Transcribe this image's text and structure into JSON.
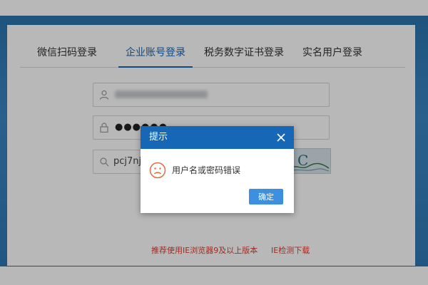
{
  "tabs": [
    {
      "label": "微信扫码登录"
    },
    {
      "label": "企业账号登录"
    },
    {
      "label": "税务数字证书登录"
    },
    {
      "label": "实名用户登录"
    }
  ],
  "form": {
    "password_mask": "●●●●●●",
    "captcha_value": "pcj7nj",
    "captcha_image_text": "C"
  },
  "footer": {
    "browser_note": "推荐使用IE浏览器9及以上版本",
    "ie_link": "IE检测下载"
  },
  "dialog": {
    "title": "提示",
    "message": "用户名或密码错误",
    "confirm_label": "确定"
  },
  "colors": {
    "accent": "#1668b6",
    "button": "#3d8fe0",
    "warning_text": "#e23b2e"
  }
}
